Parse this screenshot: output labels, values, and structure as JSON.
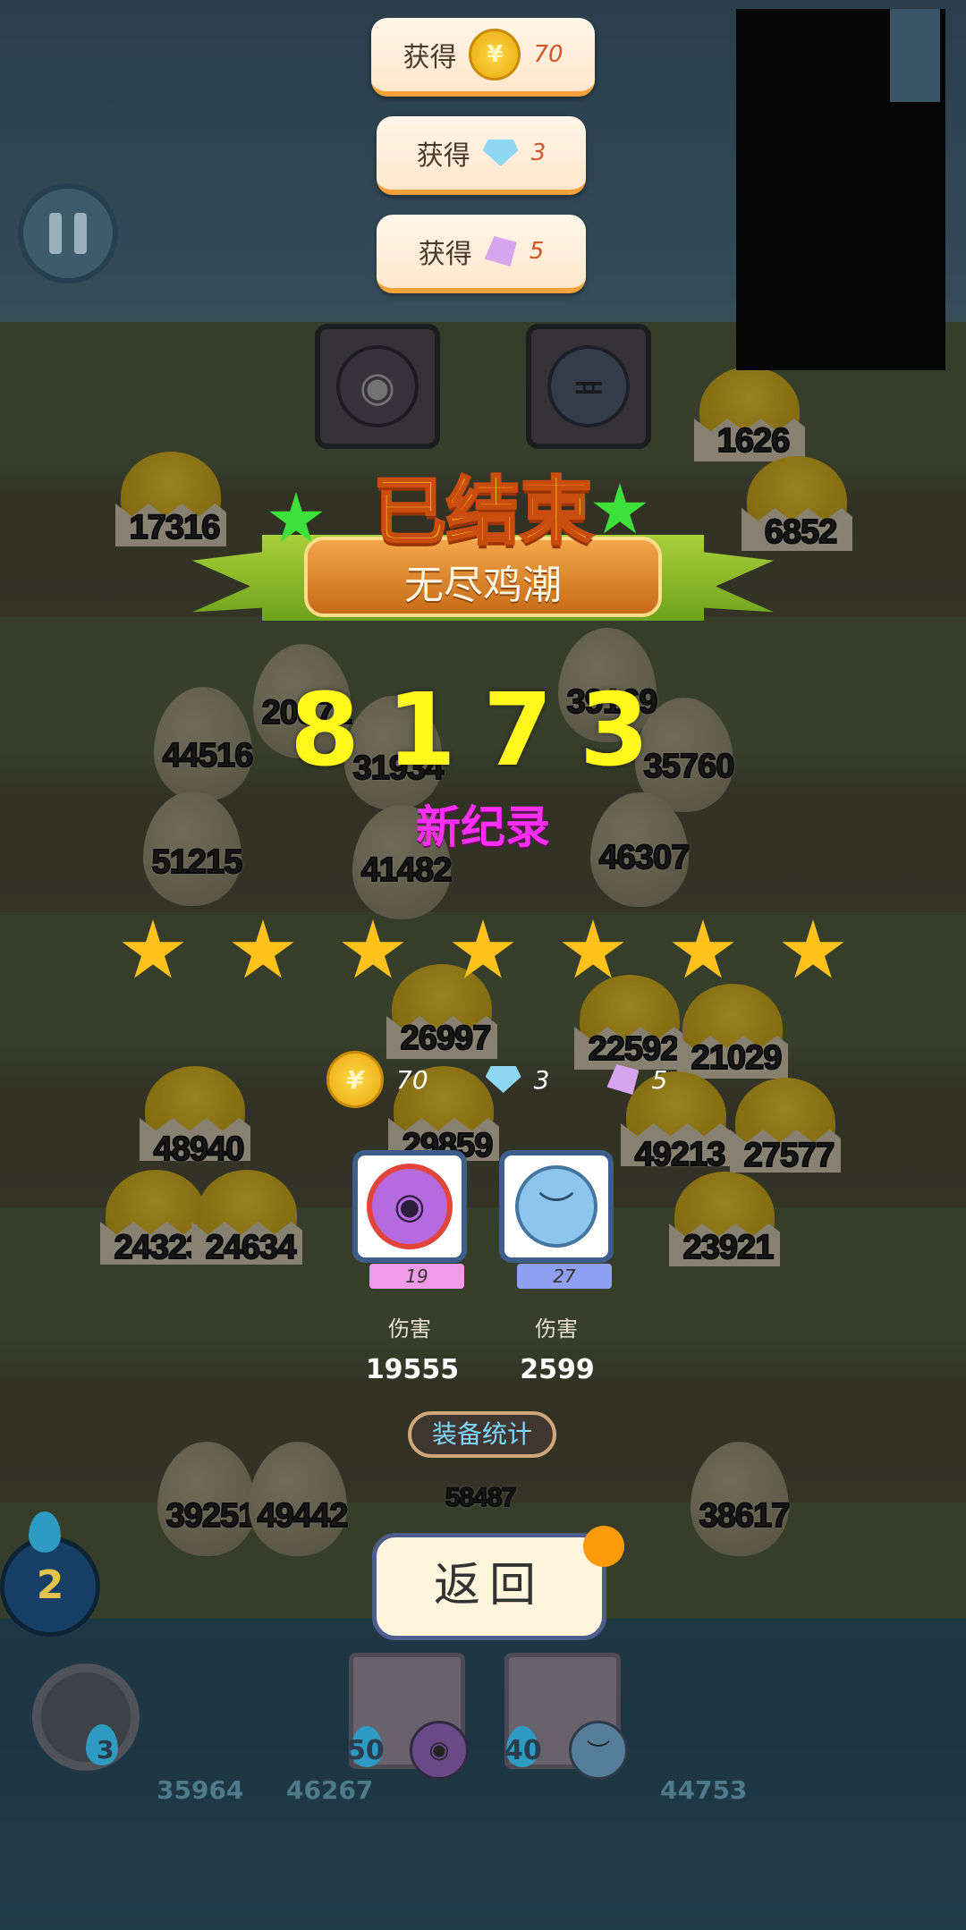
{
  "rewards_toasts": [
    {
      "label": "获得",
      "icon": "coin-icon",
      "amount": "70"
    },
    {
      "label": "获得",
      "icon": "blue-gem-icon",
      "amount": "3"
    },
    {
      "label": "获得",
      "icon": "purple-gem-icon",
      "amount": "5"
    }
  ],
  "banner": {
    "title": "已结束",
    "mode": "无尽鸡潮"
  },
  "result": {
    "score": "8173",
    "new_record": "新纪录",
    "stars_earned": 7
  },
  "field_enemies": {
    "chicks": [
      "1626",
      "17316",
      "6852",
      "26997",
      "22592",
      "21029",
      "48940",
      "49213",
      "27577",
      "24323",
      "24634",
      "23921",
      "29859"
    ],
    "eggs": [
      "20872",
      "39169",
      "44516",
      "31934",
      "35760",
      "51215",
      "41482",
      "46307",
      "39251",
      "49442",
      "38617"
    ],
    "boss_hp": "58487"
  },
  "summary_rewards": {
    "coin": "70",
    "blue_gem": "3",
    "purple_gem": "5"
  },
  "pets": [
    {
      "level": "19",
      "damage_label": "伤害",
      "damage": "19555",
      "icon": "headphone-purple-pet-icon",
      "tag_color": "#f19ae8"
    },
    {
      "level": "27",
      "damage_label": "伤害",
      "damage": "2599",
      "icon": "blue-frown-pet-icon",
      "tag_color": "#8fa0f2"
    }
  ],
  "buttons": {
    "equip_stats": "装备统计",
    "back": "返回"
  },
  "hud": {
    "energy": "2",
    "target_count": "3",
    "slot_costs": [
      "50",
      "40"
    ],
    "ghost_values": [
      "35964",
      "46267",
      "44753"
    ]
  }
}
